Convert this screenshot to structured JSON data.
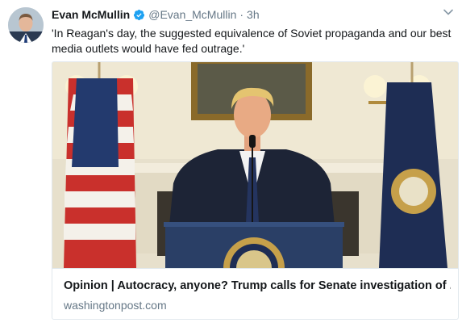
{
  "tweet": {
    "display_name": "Evan McMullin",
    "handle": "@Evan_McMullin",
    "separator": "·",
    "time": "3h",
    "text": "'In Reagan's day, the suggested equivalence of Soviet propaganda and our best media outlets would have fed outrage.'",
    "verified_icon": "verified-badge-icon",
    "menu_icon": "chevron-down-icon"
  },
  "card": {
    "title": "Opinion | Autocracy, anyone? Trump calls for Senate investigation of ...",
    "domain": "washingtonpost.com"
  },
  "colors": {
    "text": "#14171a",
    "secondary": "#657786",
    "verified": "#1da1f2",
    "border": "#e1e8ed"
  }
}
